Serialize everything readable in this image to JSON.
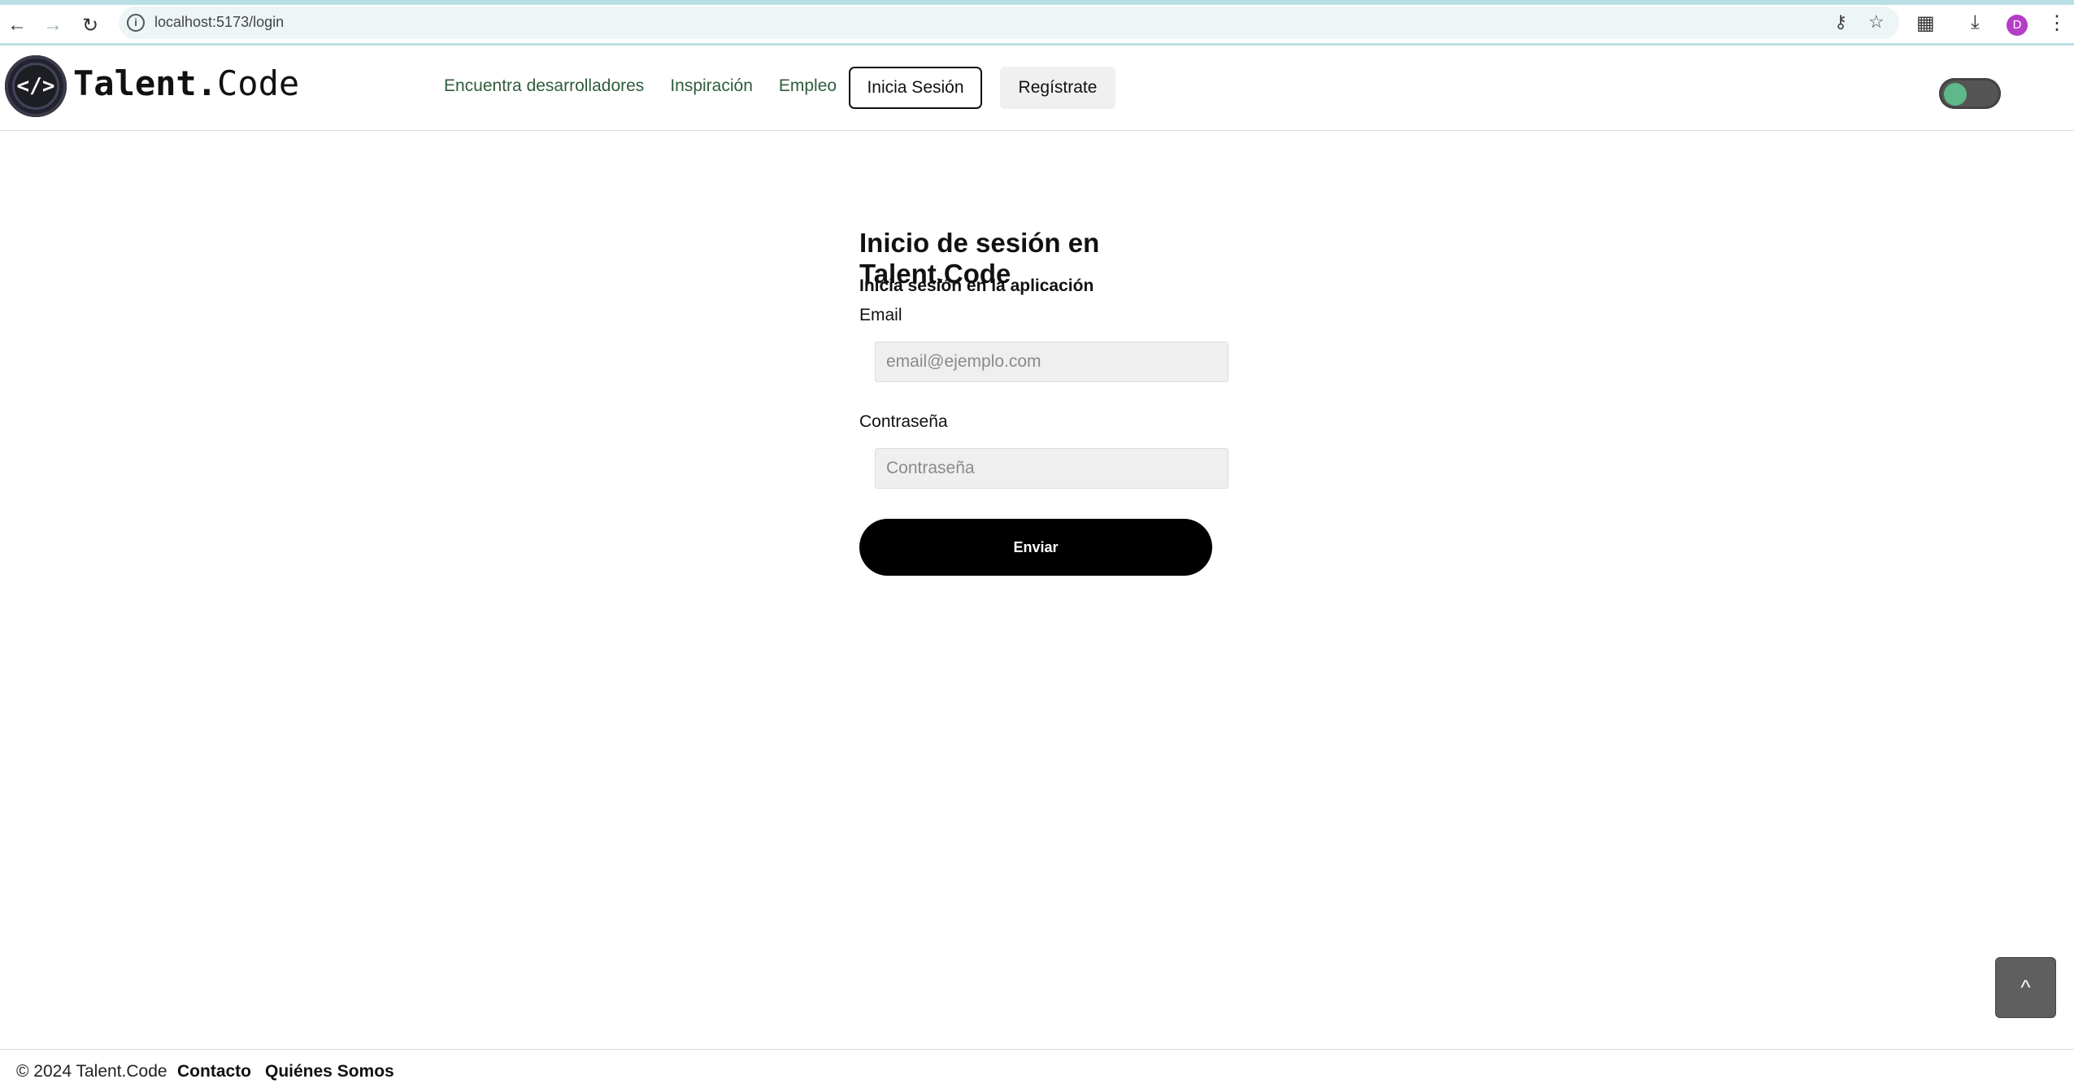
{
  "browser": {
    "url": "localhost:5173/login",
    "avatar_letter": "D"
  },
  "header": {
    "logo_glyph": "</>",
    "brand_name_bold": "Talent.",
    "brand_name_light": "Code",
    "nav": [
      {
        "label": "Encuentra desarrolladores"
      },
      {
        "label": "Inspiración"
      },
      {
        "label": "Empleo"
      }
    ],
    "login_label": "Inicia Sesión",
    "register_label": "Regístrate",
    "accent_color": "#2f5c3c",
    "toggle_color": "#5fb88a"
  },
  "login": {
    "title": "Inicio de sesión en Talent.Code",
    "subtitle": "Inicia sesión en la aplicación",
    "email_label": "Email",
    "email_placeholder": "email@ejemplo.com",
    "email_value": "",
    "password_label": "Contraseña",
    "password_placeholder": "Contraseña",
    "password_value": "",
    "submit_label": "Enviar"
  },
  "scroll_top_label": "^",
  "footer": {
    "copyright": "© 2024 Talent.Code",
    "links": [
      {
        "label": "Contacto"
      },
      {
        "label": "Quiénes Somos"
      }
    ]
  }
}
